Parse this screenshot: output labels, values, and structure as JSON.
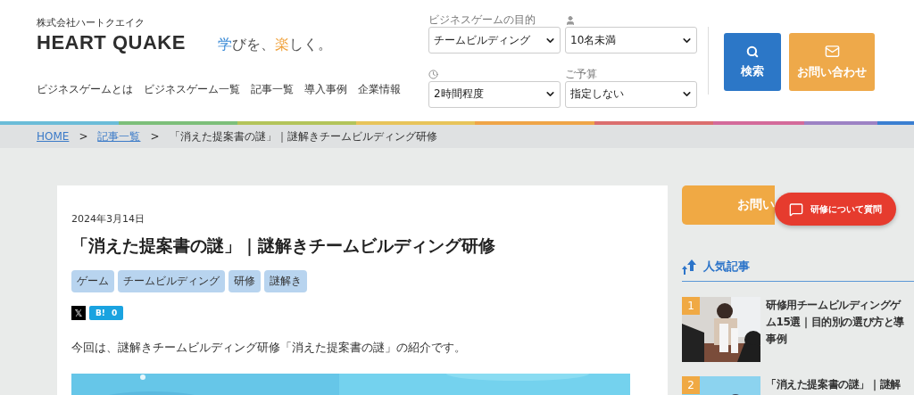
{
  "header": {
    "company": "株式会社ハートクエイク",
    "logo": "HEART QUAKE",
    "tagline": [
      {
        "text": "学",
        "color": "#3a8ad6"
      },
      {
        "text": "びを、"
      },
      {
        "text": "楽",
        "color": "#f0a23c"
      },
      {
        "text": "しく。"
      }
    ],
    "nav": [
      "ビジネスゲームとは",
      "ビジネスゲーム一覧",
      "記事一覧",
      "導入事例",
      "企業情報"
    ],
    "filters": [
      {
        "kind": "text",
        "label": "ビジネスゲームの目的",
        "value": "チームビルディング"
      },
      {
        "kind": "person",
        "value": "10名未満"
      },
      {
        "kind": "clock",
        "value": "2時間程度"
      },
      {
        "kind": "text",
        "label": "ご予算",
        "value": "指定しない"
      }
    ],
    "search_button": "検索",
    "contact_button": "お問い合わせ"
  },
  "breadcrumb": [
    {
      "label": "HOME",
      "link": true
    },
    {
      "label": "記事一覧",
      "link": true
    },
    {
      "label": "「消えた提案書の謎」｜謎解きチームビルディング研修",
      "link": false
    }
  ],
  "breadcrumb_separator": ">",
  "article": {
    "date": "2024年3月14日",
    "title": "「消えた提案書の謎」｜謎解きチームビルディング研修",
    "tags": [
      "ゲーム",
      "チームビルディング",
      "研修",
      "謎解き"
    ],
    "share": {
      "x": "𝕏",
      "hatena": "B!",
      "hatena_count": "0"
    },
    "intro": "今回は、謎解きチームビルディング研修「消えた提案書の謎」の紹介です。",
    "image": {
      "kind": "picture"
    }
  },
  "sidebar": {
    "contact_button": "お問い",
    "floating_button": "研修について質問",
    "popular_title": "人気記事",
    "popular": [
      {
        "rank": "1",
        "lines": [
          "研修用チームビルディングゲ",
          "ム15選｜目的別の選び方と導",
          "事例"
        ]
      },
      {
        "rank": "2",
        "lines": [
          "「消えた提案書の謎」｜謎解"
        ]
      }
    ]
  }
}
